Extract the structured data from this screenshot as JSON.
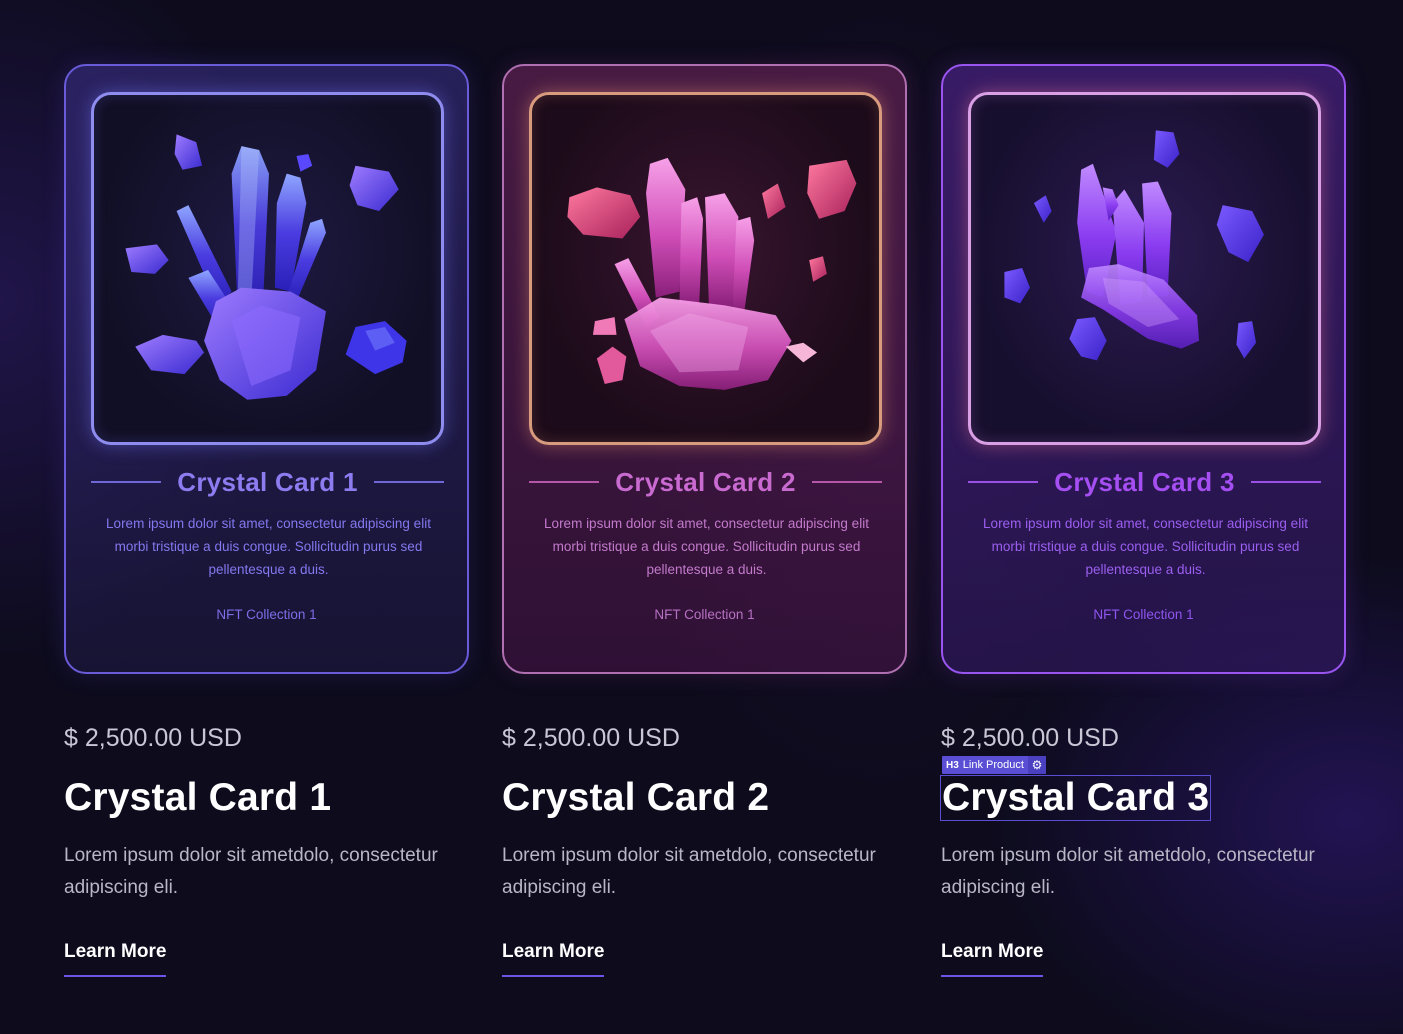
{
  "products": [
    {
      "card_title": "Crystal Card 1",
      "card_description": "Lorem ipsum dolor sit amet, consectetur adipiscing elit morbi tristique a duis congue. Sollicitudin purus sed pellentesque a duis.",
      "collection": "NFT Collection 1",
      "price": "$ 2,500.00 USD",
      "title": "Crystal Card 1",
      "description": "Lorem ipsum dolor sit ametdolo, consectetur adipiscing eli.",
      "cta": "Learn More",
      "theme_color": "#6a5bd8",
      "crystal_color": "#4a3ce0"
    },
    {
      "card_title": "Crystal Card 2",
      "card_description": "Lorem ipsum dolor sit amet, consectetur adipiscing elit morbi tristique a duis congue. Sollicitudin purus sed pellentesque a duis.",
      "collection": "NFT Collection 1",
      "price": "$ 2,500.00 USD",
      "title": "Crystal Card 2",
      "description": "Lorem ipsum dolor sit ametdolo, consectetur adipiscing eli.",
      "cta": "Learn More",
      "theme_color": "#b06fb0",
      "crystal_color": "#d04fb8"
    },
    {
      "card_title": "Crystal Card 3",
      "card_description": "Lorem ipsum dolor sit amet, consectetur adipiscing elit morbi tristique a duis congue. Sollicitudin purus sed pellentesque a duis.",
      "collection": "NFT Collection 1",
      "price": "$ 2,500.00 USD",
      "title": "Crystal Card 3",
      "description": "Lorem ipsum dolor sit ametdolo, consectetur adipiscing eli.",
      "cta": "Learn More",
      "theme_color": "#9a55f0",
      "crystal_color": "#8a3cf0"
    }
  ],
  "editor_tag": {
    "heading_level": "H3",
    "label": "Link Product",
    "icon": "gear-icon"
  },
  "colors": {
    "background": "#0d0b1c",
    "accent": "#6a55e6"
  }
}
